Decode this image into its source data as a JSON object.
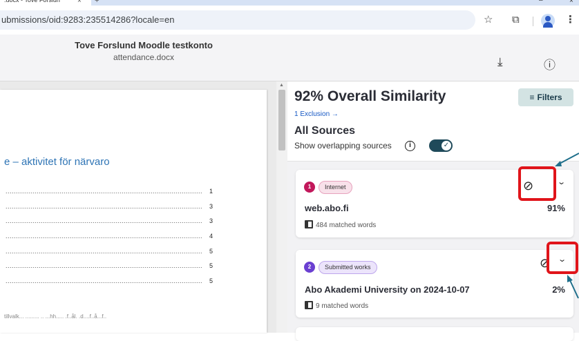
{
  "browser": {
    "tab_title": ".docx - Tove Forslun",
    "tab_close": "×",
    "new_tab": "+",
    "minimize": "–",
    "close": "×",
    "url": "ubmissions/oid:9283:235514286?locale=en",
    "bookmark_icon": "star-icon",
    "extensions_icon": "puzzle-icon"
  },
  "viewer": {
    "owner": "Tove Forslund Moodle testkonto",
    "filename": "attendance.docx",
    "download_icon": "download-icon",
    "info_icon": "info-icon"
  },
  "document": {
    "heading": "e – aktivitet för närvaro",
    "toc": [
      {
        "dots": "........................................................................................................",
        "page": "1"
      },
      {
        "dots": "........................................................................................................",
        "page": "3"
      },
      {
        "dots": "........................................................................................................",
        "page": "3"
      },
      {
        "dots": "........................................................................................................",
        "page": "4"
      },
      {
        "dots": "........................................................................................................",
        "page": "5"
      },
      {
        "dots": "........................................................................................................",
        "page": "5"
      },
      {
        "dots": "........................................................................................................",
        "page": "5"
      }
    ],
    "bottom_text": "tillvalk... ......... .. ...hh..... .f..ål. .d....f..å...f.."
  },
  "panel": {
    "title": "92% Overall Similarity",
    "filters_label": "Filters",
    "filters_icon": "≡",
    "exclusion_text": "1 Exclusion",
    "exclusion_arrow": "→",
    "all_sources": "All Sources",
    "overlap_label": "Show overlapping sources",
    "info_glyph": "i",
    "toggle_glyph": "✓",
    "toggle_on": true
  },
  "sources": [
    {
      "number": "1",
      "type": "Internet",
      "name": "web.abo.fi",
      "percent": "91%",
      "matched": "484 matched words",
      "number_color": "#c2185b",
      "badge_bg": "#f8e1ea",
      "badge_border": "#e7a2bd"
    },
    {
      "number": "2",
      "type": "Submitted works",
      "name": "Abo Akademi University on 2024-10-07",
      "percent": "2%",
      "matched": "9 matched words",
      "number_color": "#6a3fd1",
      "badge_bg": "#ece4fb",
      "badge_border": "#bda6ec"
    }
  ],
  "icons": {
    "exclude": "⊘",
    "chevron": "⌄",
    "download": "⤓",
    "info": "ⓘ",
    "star": "☆",
    "puzzle": "⧉"
  },
  "annotation_color": "#e0141a",
  "arrow_color": "#1f6f8b"
}
